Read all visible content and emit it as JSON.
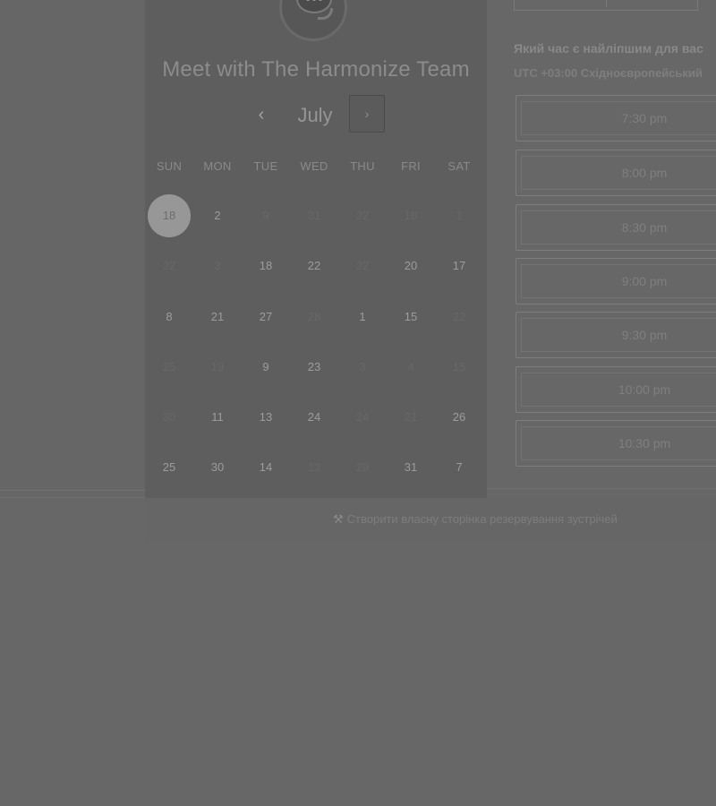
{
  "calendar": {
    "title": "Meet with The Harmonize Team",
    "month": "July",
    "prev_icon": "chevron-left-icon",
    "next_icon": "chevron-right-icon",
    "weekdays": [
      "SUN",
      "MON",
      "TUE",
      "WED",
      "THU",
      "FRI",
      "SAT"
    ],
    "weeks": [
      [
        {
          "d": "18",
          "s": "sel"
        },
        {
          "d": "2",
          "s": "on"
        },
        {
          "d": "9",
          "s": "off"
        },
        {
          "d": "31",
          "s": "off"
        },
        {
          "d": "22",
          "s": "off"
        },
        {
          "d": "18",
          "s": "off"
        },
        {
          "d": "1",
          "s": "off"
        }
      ],
      [
        {
          "d": "22",
          "s": "off"
        },
        {
          "d": "3",
          "s": "off"
        },
        {
          "d": "18",
          "s": "on"
        },
        {
          "d": "22",
          "s": "on"
        },
        {
          "d": "22",
          "s": "off"
        },
        {
          "d": "20",
          "s": "on"
        },
        {
          "d": "17",
          "s": "on"
        }
      ],
      [
        {
          "d": "8",
          "s": "on"
        },
        {
          "d": "21",
          "s": "on"
        },
        {
          "d": "27",
          "s": "on"
        },
        {
          "d": "28",
          "s": "off"
        },
        {
          "d": "1",
          "s": "on"
        },
        {
          "d": "15",
          "s": "on"
        },
        {
          "d": "22",
          "s": "off"
        }
      ],
      [
        {
          "d": "25",
          "s": "off"
        },
        {
          "d": "19",
          "s": "off"
        },
        {
          "d": "9",
          "s": "on"
        },
        {
          "d": "23",
          "s": "on"
        },
        {
          "d": "3",
          "s": "off"
        },
        {
          "d": "4",
          "s": "off"
        },
        {
          "d": "15",
          "s": "off"
        }
      ],
      [
        {
          "d": "30",
          "s": "off"
        },
        {
          "d": "11",
          "s": "on"
        },
        {
          "d": "13",
          "s": "on"
        },
        {
          "d": "24",
          "s": "on"
        },
        {
          "d": "24",
          "s": "off"
        },
        {
          "d": "21",
          "s": "off"
        },
        {
          "d": "26",
          "s": "on"
        }
      ],
      [
        {
          "d": "25",
          "s": "on"
        },
        {
          "d": "30",
          "s": "on"
        },
        {
          "d": "14",
          "s": "on"
        },
        {
          "d": "13",
          "s": "off"
        },
        {
          "d": "29",
          "s": "off"
        },
        {
          "d": "31",
          "s": "on"
        },
        {
          "d": "7",
          "s": "on"
        }
      ]
    ]
  },
  "scheduler": {
    "question": "Який час є найліпшим для вас",
    "timezone": "UTC +03:00 Східноєвропейський",
    "slots": [
      "7:30 pm",
      "8:00 pm",
      "8:30 pm",
      "9:00 pm",
      "9:30 pm",
      "10:00 pm",
      "10:30 pm"
    ]
  },
  "footer": {
    "link_text": "Створити власну сторінка резервування зустрічей",
    "link_icon": "wrench-icon"
  }
}
